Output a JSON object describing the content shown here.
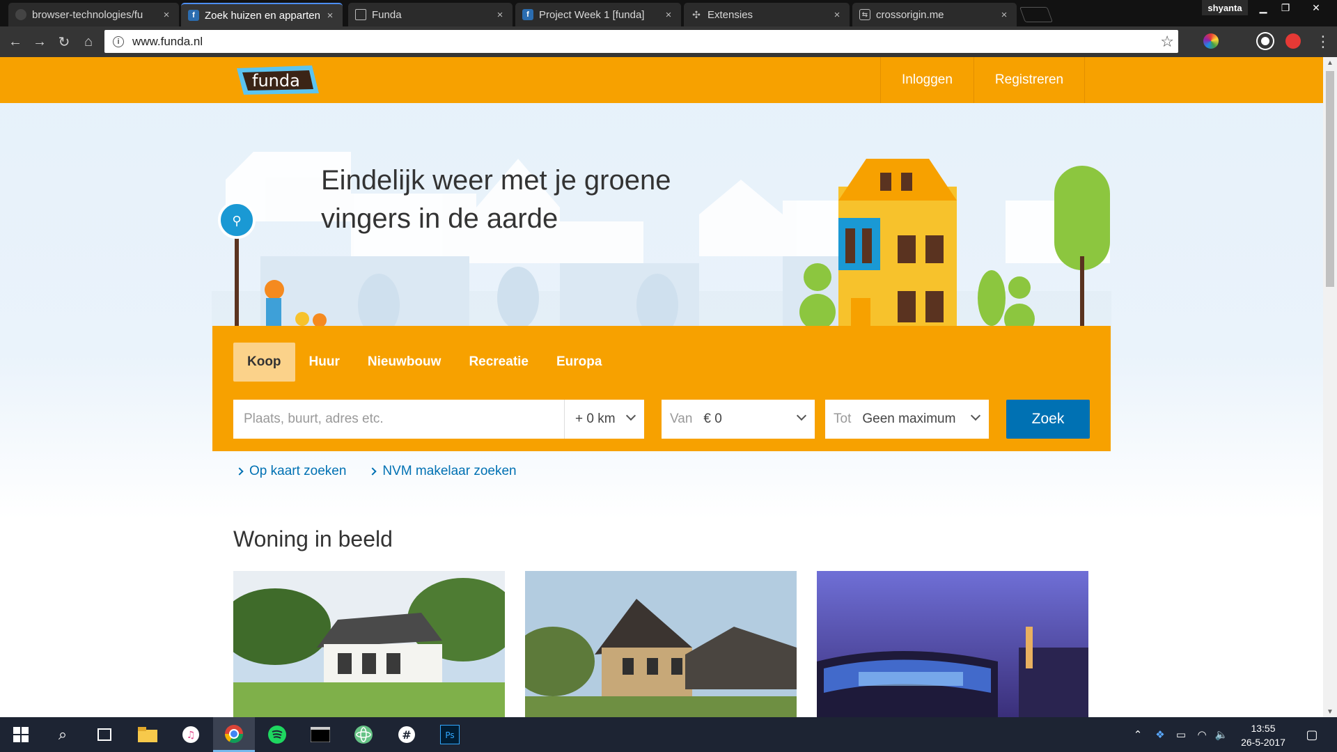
{
  "browser": {
    "tabs": [
      {
        "title": "browser-technologies/fu",
        "favicon": "github-icon"
      },
      {
        "title": "Zoek huizen en apparten",
        "favicon": "funda-icon",
        "active": true
      },
      {
        "title": "Funda",
        "favicon": "page-icon"
      },
      {
        "title": "Project Week 1 [funda]",
        "favicon": "funda-icon"
      },
      {
        "title": "Extensies",
        "favicon": "puzzle-icon"
      },
      {
        "title": "crossorigin.me",
        "favicon": "swap-icon"
      }
    ],
    "profile_name": "shyanta",
    "url": "www.funda.nl"
  },
  "header": {
    "login_label": "Inloggen",
    "register_label": "Registreren",
    "logo_text": "funda"
  },
  "hero": {
    "title_line1": "Eindelijk weer met je groene",
    "title_line2": "vingers in de aarde"
  },
  "search": {
    "tabs": [
      "Koop",
      "Huur",
      "Nieuwbouw",
      "Recreatie",
      "Europa"
    ],
    "active_tab": "Koop",
    "location_placeholder": "Plaats, buurt, adres etc.",
    "radius_value": "+ 0 km",
    "price_from_label": "Van",
    "price_from_value": "€ 0",
    "price_to_label": "Tot",
    "price_to_value": "Geen maximum",
    "submit_label": "Zoek"
  },
  "quick_links": [
    "Op kaart zoeken",
    "NVM makelaar zoeken"
  ],
  "section": {
    "title": "Woning in beeld"
  },
  "taskbar": {
    "time": "13:55",
    "date": "26-5-2017"
  },
  "colors": {
    "brand_orange": "#f7a100",
    "brand_blue": "#0071b3",
    "chrome_dark": "#353535"
  }
}
